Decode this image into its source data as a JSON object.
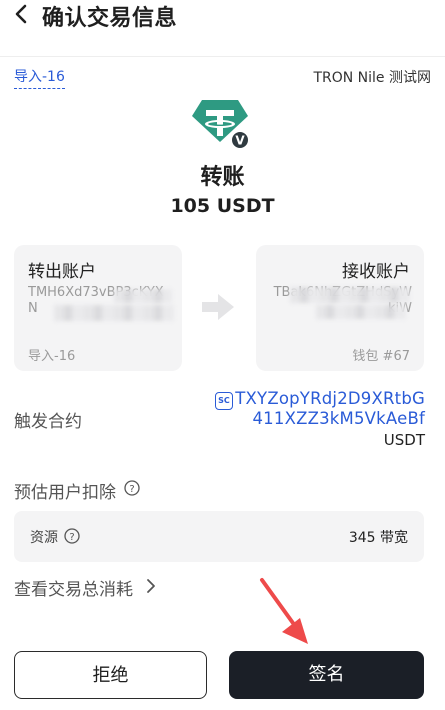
{
  "header": {
    "title": "确认交易信息"
  },
  "account": {
    "name": "导入-16",
    "network": "TRON Nile 测试网"
  },
  "transaction": {
    "type": "转账",
    "amount": "105 USDT"
  },
  "from_account": {
    "label": "转出账户",
    "address": "TMH6Xd73vBP3cKYXN",
    "wallet": "导入-16"
  },
  "to_account": {
    "label": "接收账户",
    "address": "TBak6NhZGtZHdSyWkiW",
    "wallet": "钱包 #67"
  },
  "contract": {
    "label": "触发合约",
    "badge": "SC",
    "address": "TXYZopYRdj2D9XRtbG411XZZ3kM5VkAeBf",
    "token": "USDT"
  },
  "deduction": {
    "label": "预估用户扣除",
    "resource_label": "资源",
    "resource_value": "345 带宽"
  },
  "view_total": {
    "label": "查看交易总消耗"
  },
  "buttons": {
    "reject": "拒绝",
    "sign": "签名"
  },
  "colors": {
    "accent_blue": "#2a5bd7",
    "tether_green": "#2e9a82",
    "sign_button": "#1b1f27",
    "card_bg": "#f4f4f5",
    "annotation_arrow": "#ee4a4a"
  }
}
